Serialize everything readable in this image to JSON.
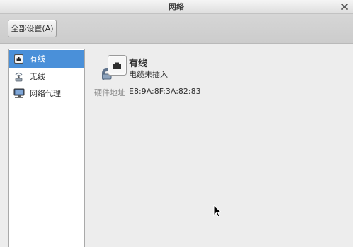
{
  "window": {
    "title": "网络",
    "close_icon": "close-icon"
  },
  "toolbar": {
    "all_settings": {
      "prefix": "全部设置(",
      "mnemonic": "A",
      "suffix": ")"
    }
  },
  "sidebar": {
    "items": [
      {
        "label": "有线",
        "icon": "wired-network-icon",
        "selected": true
      },
      {
        "label": "无线",
        "icon": "wireless-network-icon",
        "selected": false
      },
      {
        "label": "网络代理",
        "icon": "network-proxy-icon",
        "selected": false
      }
    ]
  },
  "detail": {
    "icon": "wired-network-icon",
    "title": "有线",
    "status": "电缆未插入",
    "hardware_address_label": "硬件地址",
    "hardware_address_value": "E8:9A:8F:3A:82:83"
  },
  "colors": {
    "selection": "#4a90d9",
    "secondary_text": "#8c8c8c"
  }
}
